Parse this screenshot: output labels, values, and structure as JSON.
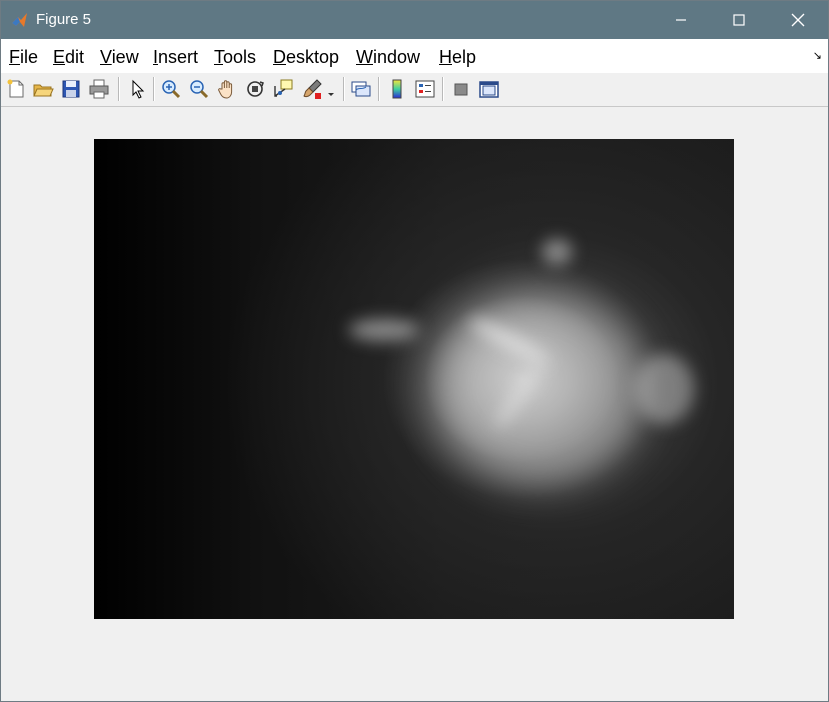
{
  "window": {
    "title": "Figure 5"
  },
  "menu": [
    {
      "label": "File",
      "mnemonic": "F",
      "rest": "ile"
    },
    {
      "label": "Edit",
      "mnemonic": "E",
      "rest": "dit"
    },
    {
      "label": "View",
      "mnemonic": "V",
      "rest": "iew"
    },
    {
      "label": "Insert",
      "mnemonic": "I",
      "rest": "nsert"
    },
    {
      "label": "Tools",
      "mnemonic": "T",
      "rest": "ools"
    },
    {
      "label": "Desktop",
      "mnemonic": "D",
      "rest": "esktop"
    },
    {
      "label": "Window",
      "mnemonic": "W",
      "rest": "indow"
    },
    {
      "label": "Help",
      "mnemonic": "H",
      "rest": "elp"
    }
  ],
  "toolbar": {
    "buttons": [
      "new-figure-icon",
      "open-file-icon",
      "save-icon",
      "print-icon",
      "edit-plot-icon",
      "zoom-in-icon",
      "zoom-out-icon",
      "pan-icon",
      "rotate-3d-icon",
      "data-cursor-icon",
      "brush-icon",
      "link-plot-icon",
      "colorbar-icon",
      "legend-icon",
      "hide-plot-tools-icon",
      "show-plot-tools-icon"
    ]
  },
  "image": {
    "description_colormap": "gray",
    "colors": {
      "background": "#000000",
      "highlight": "#d9d9d9"
    }
  }
}
